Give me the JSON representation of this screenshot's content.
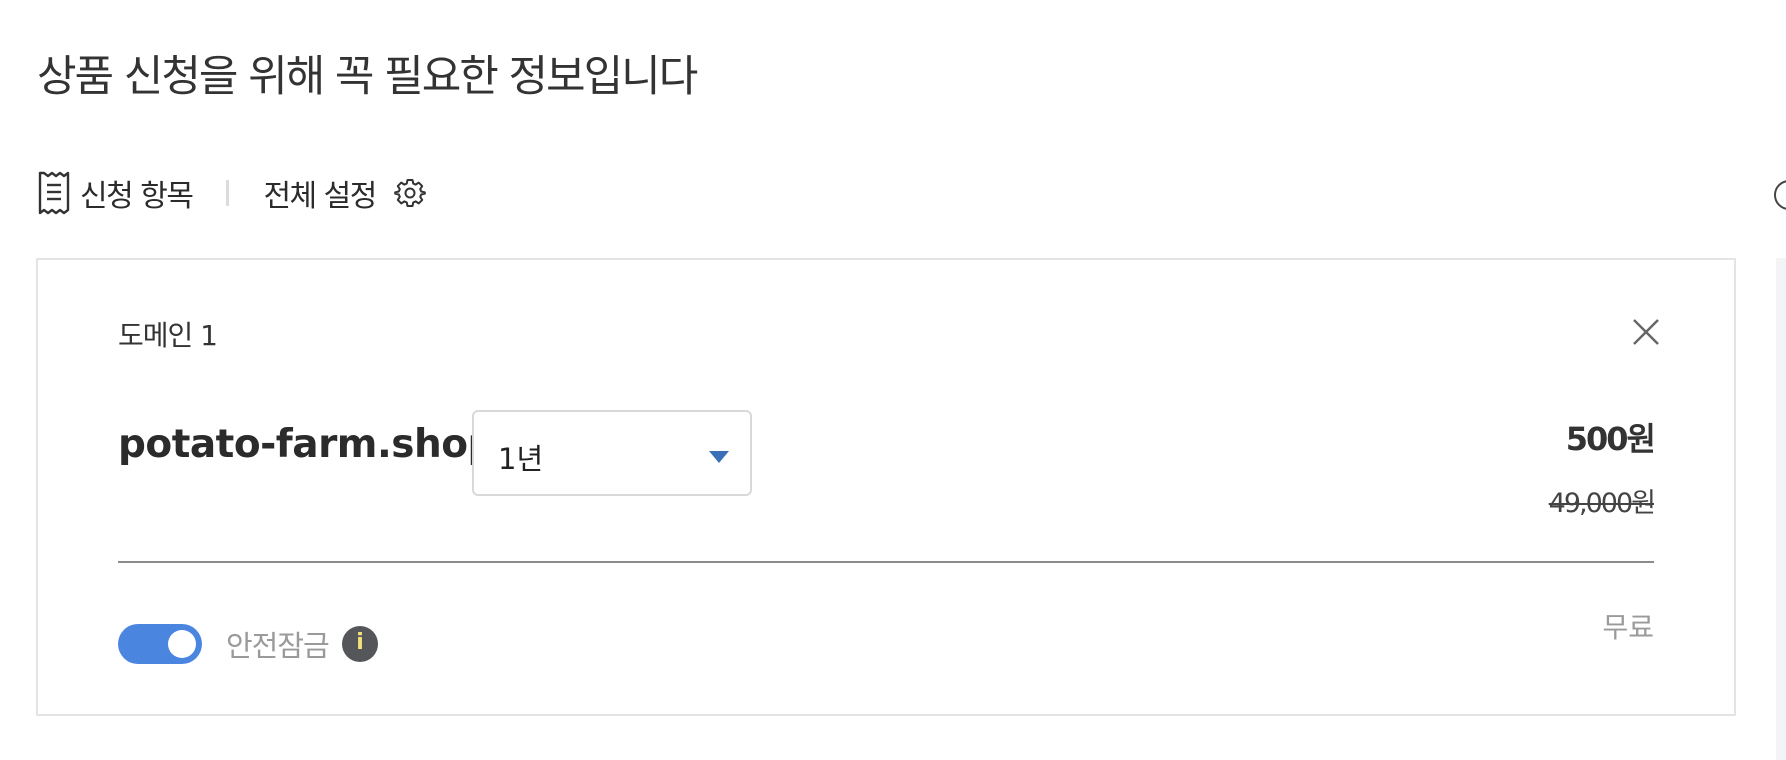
{
  "page_title": "상품 신청을 위해 꼭 필요한 정보입니다",
  "tabs": {
    "items_label": "신청 항목",
    "settings_label": "전체 설정"
  },
  "icons": {
    "receipt": "receipt-icon",
    "settings": "gear-icon",
    "close": "close-icon",
    "dropdown": "caret-down-icon",
    "info": "info-icon"
  },
  "card": {
    "label": "도메인 1",
    "domain_name": "potato-farm.shop",
    "period_select": {
      "selected": "1년"
    },
    "price": "500원",
    "original_price": "49,000원",
    "option": {
      "label": "안전잠금",
      "enabled": true,
      "price": "무료",
      "info_glyph": "i"
    }
  },
  "colors": {
    "accent": "#4a86e0",
    "caret": "#3b6fb6",
    "info_bg": "#55565a",
    "info_glyph": "#f3e27a",
    "muted_text": "#9a9a9a",
    "border": "#e4e4e4"
  }
}
